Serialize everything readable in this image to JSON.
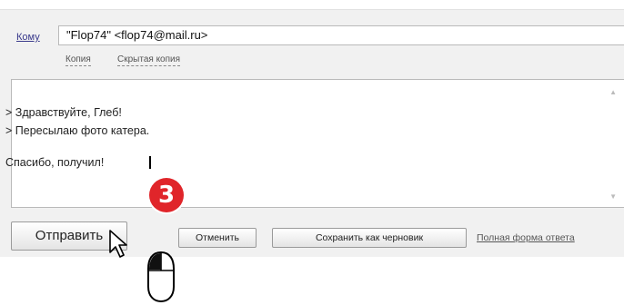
{
  "compose": {
    "to_label": "Кому",
    "to_value": "\"Flop74\" <flop74@mail.ru>",
    "cc_label": "Копия",
    "bcc_label": "Скрытая копия"
  },
  "body": {
    "lines": [
      "> Здравствуйте, Глеб!",
      "> Пересылаю фото катера.",
      "Спасибо, получил!"
    ]
  },
  "actions": {
    "send": "Отправить",
    "cancel": "Отменить",
    "save_draft": "Сохранить как черновик",
    "full_form": "Полная форма ответа"
  },
  "annotation": {
    "step_number": "3",
    "step_color": "#e0252a"
  },
  "icons": [
    "arrow-cursor-icon",
    "mouse-icon"
  ]
}
